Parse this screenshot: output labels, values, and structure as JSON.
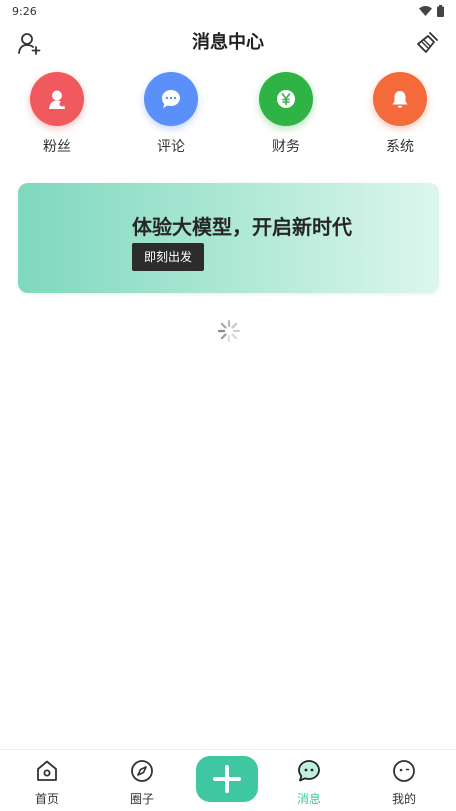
{
  "status_bar": {
    "time": "9:26"
  },
  "header": {
    "title": "消息中心",
    "add_friend_icon": "user-plus-icon",
    "clean_icon": "broom-icon"
  },
  "categories": [
    {
      "label": "粉丝",
      "icon": "user-icon",
      "color": "#f0595e"
    },
    {
      "label": "评论",
      "icon": "chat-bubble-icon",
      "color": "#5b8ff9"
    },
    {
      "label": "财务",
      "icon": "yen-coin-icon",
      "color": "#2fb344"
    },
    {
      "label": "系统",
      "icon": "bell-icon",
      "color": "#f56a3a"
    }
  ],
  "banner": {
    "title": "体验大模型，开启新时代",
    "button_label": "即刻出发"
  },
  "bottom_nav": {
    "accent_color": "#3ec7a1",
    "items": [
      {
        "label": "首页",
        "icon": "home-icon"
      },
      {
        "label": "圈子",
        "icon": "compass-icon"
      },
      {
        "label": "消息",
        "icon": "message-icon",
        "active": true
      },
      {
        "label": "我的",
        "icon": "profile-face-icon"
      }
    ],
    "publish_icon": "plus-icon"
  }
}
